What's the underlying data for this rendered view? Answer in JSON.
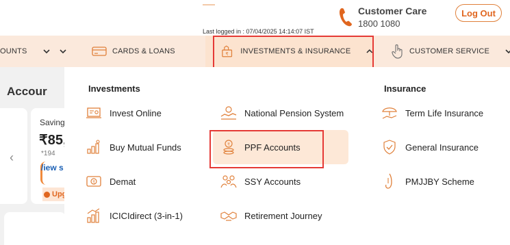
{
  "header": {
    "customer_care": {
      "title": "Customer Care",
      "phone": "1800 1080"
    },
    "logout_label": "Log Out",
    "last_login": "Last logged in : 07/04/2025 14:14:07 IST"
  },
  "nav": {
    "accounts_label": "OUNTS",
    "cards_label": "CARDS & LOANS",
    "investments_label": "INVESTMENTS & INSURANCE",
    "service_label": "CUSTOMER SERVICE"
  },
  "background": {
    "section_title": "Accour",
    "savings_label": "Saving",
    "balance": "₹85,",
    "account_no": "*194",
    "view_link": "/iew s",
    "upgrade_label": "Upg"
  },
  "dropdown": {
    "investments_heading": "Investments",
    "insurance_heading": "Insurance",
    "investments_col1": [
      {
        "label": "Invest Online",
        "icon": "laptop-icon"
      },
      {
        "label": "Buy Mutual Funds",
        "icon": "growth-chart-icon"
      },
      {
        "label": "Demat",
        "icon": "demat-icon"
      },
      {
        "label": "ICICIdirect (3-in-1)",
        "icon": "bar-chart-icon"
      }
    ],
    "investments_col2": [
      {
        "label": "National Pension System",
        "icon": "pension-icon"
      },
      {
        "label": "PPF Accounts",
        "icon": "coin-stack-icon"
      },
      {
        "label": "SSY Accounts",
        "icon": "family-icon"
      },
      {
        "label": "Retirement Journey",
        "icon": "handshake-icon"
      }
    ],
    "insurance": [
      {
        "label": "Term Life Insurance",
        "icon": "umbrella-hand-icon"
      },
      {
        "label": "General Insurance",
        "icon": "shield-check-icon"
      },
      {
        "label": "PMJJBY Scheme",
        "icon": "scheme-icon"
      }
    ]
  },
  "colors": {
    "accent": "#e0661f",
    "nav_bg": "#fbe9dc",
    "highlight": "#fde8d7",
    "annotation_red": "#e53935"
  }
}
